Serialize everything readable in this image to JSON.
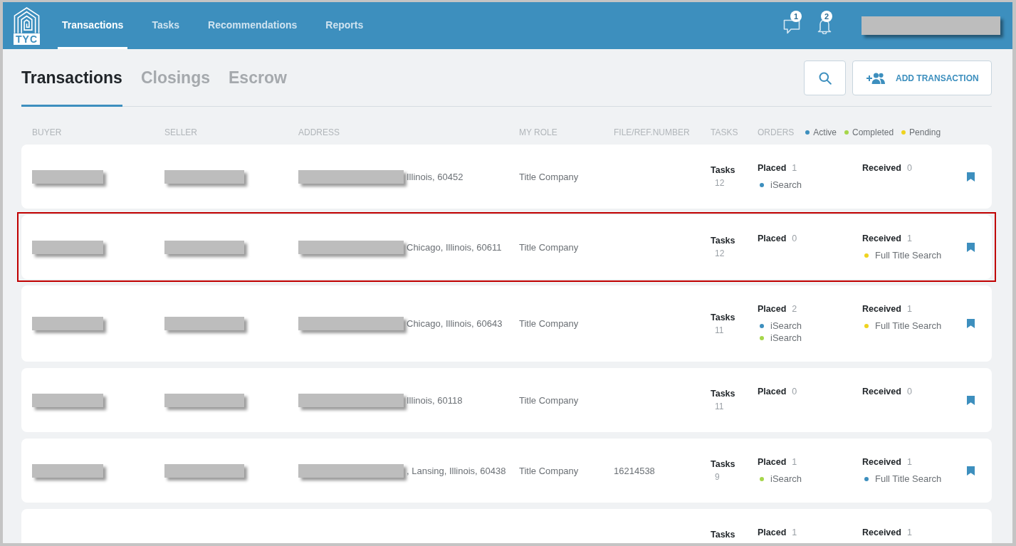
{
  "header": {
    "logo_text": "TYC",
    "nav": [
      {
        "label": "Transactions",
        "selected": true
      },
      {
        "label": "Tasks",
        "selected": false
      },
      {
        "label": "Recommendations",
        "selected": false
      },
      {
        "label": "Reports",
        "selected": false
      }
    ],
    "messages_count": "1",
    "notifications_count": "2",
    "user_name_redacted": true
  },
  "page_tabs": [
    {
      "label": "Transactions",
      "selected": true
    },
    {
      "label": "Closings",
      "selected": false
    },
    {
      "label": "Escrow",
      "selected": false
    }
  ],
  "add_button": "ADD TRANSACTION",
  "table": {
    "columns": [
      "BUYER",
      "SELLER",
      "ADDRESS",
      "MY ROLE",
      "FILE/REF.NUMBER",
      "TASKS",
      "ORDERS"
    ],
    "legend": [
      {
        "label": "Active",
        "color": "#3d8fbe"
      },
      {
        "label": "Completed",
        "color": "#a6d64a"
      },
      {
        "label": "Pending",
        "color": "#efd31f"
      }
    ],
    "rows": [
      {
        "highlighted": false,
        "buyer_redacted": true,
        "seller_redacted": true,
        "address_redacted": true,
        "address": "Illinois, 60452",
        "role": "Title Company",
        "tasks_label": "Tasks",
        "tasks_count": "12",
        "placed": {
          "label": "Placed",
          "count": "1",
          "items": [
            {
              "name": "iSearch",
              "color": "#3d8fbe"
            }
          ]
        },
        "received": {
          "label": "Received",
          "count": "0"
        },
        "bookmark": true
      },
      {
        "highlighted": true,
        "buyer_redacted": true,
        "seller_redacted": true,
        "address_redacted": true,
        "address": "Chicago, Illinois, 60611",
        "role": "Title Company",
        "tasks_label": "Tasks",
        "tasks_count": "12",
        "placed": {
          "label": "Placed",
          "count": "0"
        },
        "received": {
          "label": "Received",
          "count": "1",
          "items": [
            {
              "name": "Full Title Search",
              "color": "#efd31f"
            }
          ]
        },
        "bookmark": true
      },
      {
        "highlighted": false,
        "buyer_redacted": true,
        "seller_redacted": true,
        "address_redacted": true,
        "address": "Chicago, Illinois, 60643",
        "role": "Title Company",
        "tasks_label": "Tasks",
        "tasks_count": "11",
        "placed": {
          "label": "Placed",
          "count": "2",
          "items": [
            {
              "name": "iSearch",
              "color": "#3d8fbe"
            },
            {
              "name": "iSearch",
              "color": "#a6d64a"
            }
          ]
        },
        "received": {
          "label": "Received",
          "count": "1",
          "items": [
            {
              "name": "Full Title Search",
              "color": "#efd31f"
            }
          ]
        },
        "bookmark": true
      },
      {
        "highlighted": false,
        "buyer_redacted": true,
        "seller_redacted": true,
        "address_redacted": true,
        "address": "Illinois, 60118",
        "role": "Title Company",
        "tasks_label": "Tasks",
        "tasks_count": "11",
        "placed": {
          "label": "Placed",
          "count": "0"
        },
        "received": {
          "label": "Received",
          "count": "0"
        },
        "bookmark": true
      },
      {
        "highlighted": false,
        "buyer_redacted": true,
        "seller_redacted": true,
        "address_redacted": true,
        "address": ", Lansing, Illinois, 60438",
        "role": "Title Company",
        "file_number": "16214538",
        "tasks_label": "Tasks",
        "tasks_count": "9",
        "placed": {
          "label": "Placed",
          "count": "1",
          "items": [
            {
              "name": "iSearch",
              "color": "#a6d64a"
            }
          ]
        },
        "received": {
          "label": "Received",
          "count": "1",
          "items": [
            {
              "name": "Full Title Search",
              "color": "#3d8fbe"
            }
          ]
        },
        "bookmark": true
      },
      {
        "highlighted": false,
        "tasks_label": "Tasks",
        "placed": {
          "label": "Placed",
          "count": "1"
        },
        "received": {
          "label": "Received",
          "count": "1"
        }
      }
    ]
  }
}
